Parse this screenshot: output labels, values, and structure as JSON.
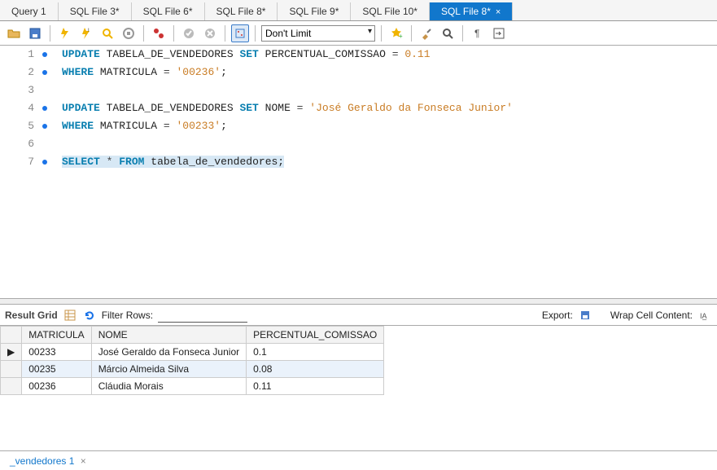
{
  "tabs": [
    {
      "label": "Query 1",
      "active": false
    },
    {
      "label": "SQL File 3*",
      "active": false
    },
    {
      "label": "SQL File 6*",
      "active": false
    },
    {
      "label": "SQL File 8*",
      "active": false
    },
    {
      "label": "SQL File 9*",
      "active": false
    },
    {
      "label": "SQL File 10*",
      "active": false
    },
    {
      "label": "SQL File 8*",
      "active": true
    }
  ],
  "tab_close_glyph": "×",
  "toolbar": {
    "limit_label": "Don't Limit"
  },
  "code": {
    "lines": [
      {
        "n": "1",
        "dot": true,
        "tokens": [
          {
            "t": "UPDATE",
            "c": "kw"
          },
          {
            "t": " TABELA_DE_VENDEDORES ",
            "c": ""
          },
          {
            "t": "SET",
            "c": "kw"
          },
          {
            "t": " PERCENTUAL_COMISSAO ",
            "c": ""
          },
          {
            "t": "=",
            "c": "op"
          },
          {
            "t": " ",
            "c": ""
          },
          {
            "t": "0.11",
            "c": "num"
          }
        ]
      },
      {
        "n": "2",
        "dot": true,
        "tokens": [
          {
            "t": "WHERE",
            "c": "kw"
          },
          {
            "t": " MATRICULA ",
            "c": ""
          },
          {
            "t": "=",
            "c": "op"
          },
          {
            "t": " ",
            "c": ""
          },
          {
            "t": "'00236'",
            "c": "str"
          },
          {
            "t": ";",
            "c": ""
          }
        ]
      },
      {
        "n": "3",
        "dot": false,
        "tokens": []
      },
      {
        "n": "4",
        "dot": true,
        "tokens": [
          {
            "t": "UPDATE",
            "c": "kw"
          },
          {
            "t": " TABELA_DE_VENDEDORES ",
            "c": ""
          },
          {
            "t": "SET",
            "c": "kw"
          },
          {
            "t": " NOME ",
            "c": ""
          },
          {
            "t": "=",
            "c": "op"
          },
          {
            "t": " ",
            "c": ""
          },
          {
            "t": "'José Geraldo da Fonseca Junior'",
            "c": "str"
          }
        ]
      },
      {
        "n": "5",
        "dot": true,
        "tokens": [
          {
            "t": "WHERE",
            "c": "kw"
          },
          {
            "t": " MATRICULA ",
            "c": ""
          },
          {
            "t": "=",
            "c": "op"
          },
          {
            "t": " ",
            "c": ""
          },
          {
            "t": "'00233'",
            "c": "str"
          },
          {
            "t": ";",
            "c": ""
          }
        ]
      },
      {
        "n": "6",
        "dot": false,
        "tokens": []
      },
      {
        "n": "7",
        "dot": true,
        "hl": true,
        "tokens": [
          {
            "t": "SELECT",
            "c": "kw"
          },
          {
            "t": " ",
            "c": ""
          },
          {
            "t": "*",
            "c": "op"
          },
          {
            "t": " ",
            "c": ""
          },
          {
            "t": "FROM",
            "c": "kw"
          },
          {
            "t": " tabela_de_vendedores;",
            "c": ""
          }
        ]
      }
    ]
  },
  "result_bar": {
    "result_grid": "Result Grid",
    "filter_label": "Filter Rows:",
    "export_label": "Export:",
    "wrap_label": "Wrap Cell Content:"
  },
  "grid": {
    "headers": [
      "MATRICULA",
      "NOME",
      "PERCENTUAL_COMISSAO"
    ],
    "rows": [
      {
        "marker": "▶",
        "sel": false,
        "cells": [
          "00233",
          "José Geraldo da Fonseca Junior",
          "0.1"
        ]
      },
      {
        "marker": "",
        "sel": true,
        "cells": [
          "00235",
          "Márcio Almeida Silva",
          "0.08"
        ]
      },
      {
        "marker": "",
        "sel": false,
        "cells": [
          "00236",
          "Cláudia Morais",
          "0.11"
        ]
      }
    ]
  },
  "bottom_tab": {
    "label": "_vendedores 1",
    "close": "×"
  }
}
